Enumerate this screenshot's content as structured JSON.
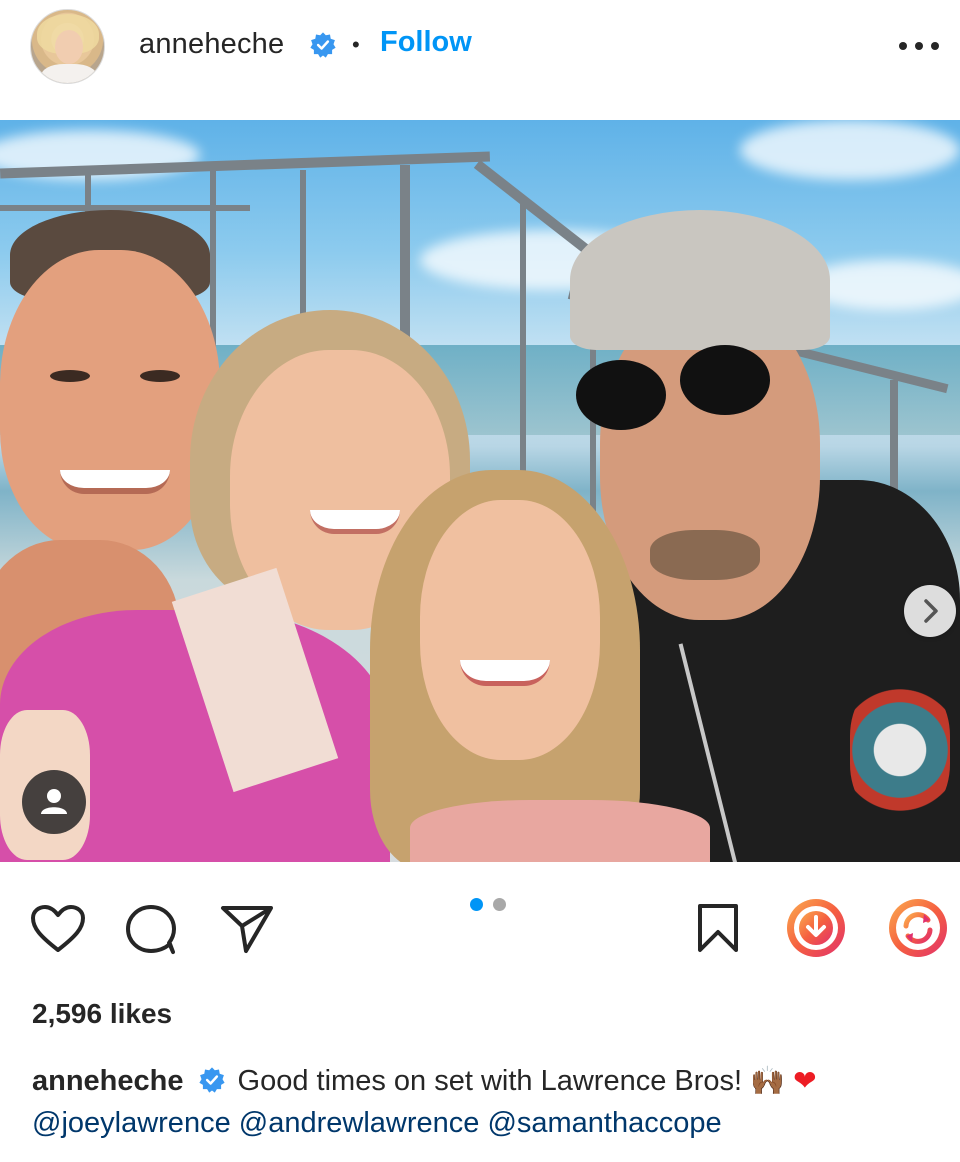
{
  "header": {
    "avatar_icon": "profile-avatar",
    "username": "anneheche",
    "verified_icon": "verified-badge-icon",
    "separator": "•",
    "follow_label": "Follow",
    "more_icon": "more-options-icon"
  },
  "post": {
    "image_alt": "Selfie of four people on a pier",
    "next_icon": "chevron-right-icon",
    "tag_icon": "user-tag-icon"
  },
  "actions": {
    "like_icon": "heart-icon",
    "comment_icon": "comment-icon",
    "share_icon": "send-icon",
    "save_icon": "bookmark-icon",
    "download_icon": "download-icon",
    "repost_icon": "repost-icon",
    "carousel_total": 2,
    "carousel_active": 1
  },
  "likes": "2,596 likes",
  "caption": {
    "username": "anneheche",
    "text": " Good times on set with Lawrence Bros! ",
    "emoji_1": "🙌🏾",
    "emoji_2": "❤",
    "mentions": [
      "@joeylawrence",
      "@andrewlawrence",
      "@samanthaccope"
    ]
  },
  "colors": {
    "accent": "#0095f6",
    "text": "#262626",
    "mention": "#00376b",
    "heart": "#ed1c24",
    "gradient_orange": "#f58529",
    "gradient_pink": "#dd2a7b"
  }
}
